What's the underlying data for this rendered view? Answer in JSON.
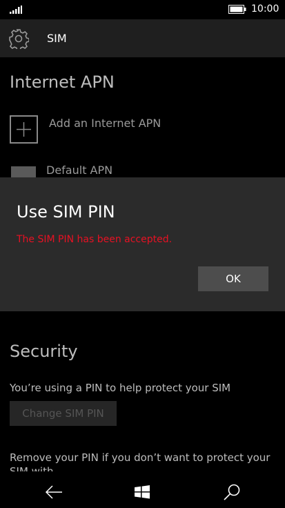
{
  "status_bar": {
    "time": "10:00",
    "signal_icon": "signal-icon",
    "battery_icon": "battery-icon"
  },
  "app_bar": {
    "title": "SIM",
    "icon": "gear-icon"
  },
  "internet_apn": {
    "heading": "Internet APN",
    "add_label": "Add an Internet APN",
    "default_label": "Default APN"
  },
  "dialog": {
    "title": "Use SIM PIN",
    "message": "The SIM PIN has been accepted.",
    "ok_label": "OK",
    "message_color": "#e81123"
  },
  "security": {
    "heading": "Security",
    "description": "You’re using a PIN to help protect your SIM",
    "change_label": "Change SIM PIN",
    "remove_text": "Remove your PIN if you don’t want to protect your SIM with"
  },
  "nav_bar": {
    "back_icon": "back-arrow-icon",
    "home_icon": "windows-logo-icon",
    "search_icon": "search-icon"
  }
}
